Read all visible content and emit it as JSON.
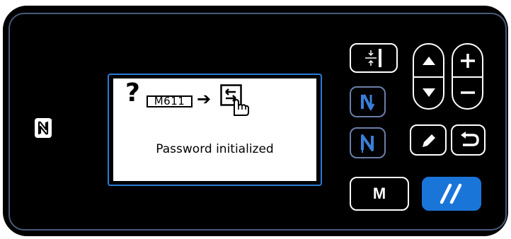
{
  "lcd": {
    "error_code": "M611",
    "arrow": "➔",
    "message": "Password initialized"
  },
  "buttons": {
    "menu_label": "M"
  },
  "colors": {
    "panel": "#000000",
    "lcd_frame": "#2b7bd8",
    "accent_blue": "#1a75d8"
  },
  "icons": [
    "nfc-icon",
    "question-mark-icon",
    "retry-hand-icon",
    "thread-trimmer-icon",
    "needle-up-down-icon",
    "needle-position-icon",
    "up-arrow-icon",
    "down-arrow-icon",
    "plus-icon",
    "minus-icon",
    "pencil-icon",
    "return-icon",
    "reset-icon"
  ]
}
